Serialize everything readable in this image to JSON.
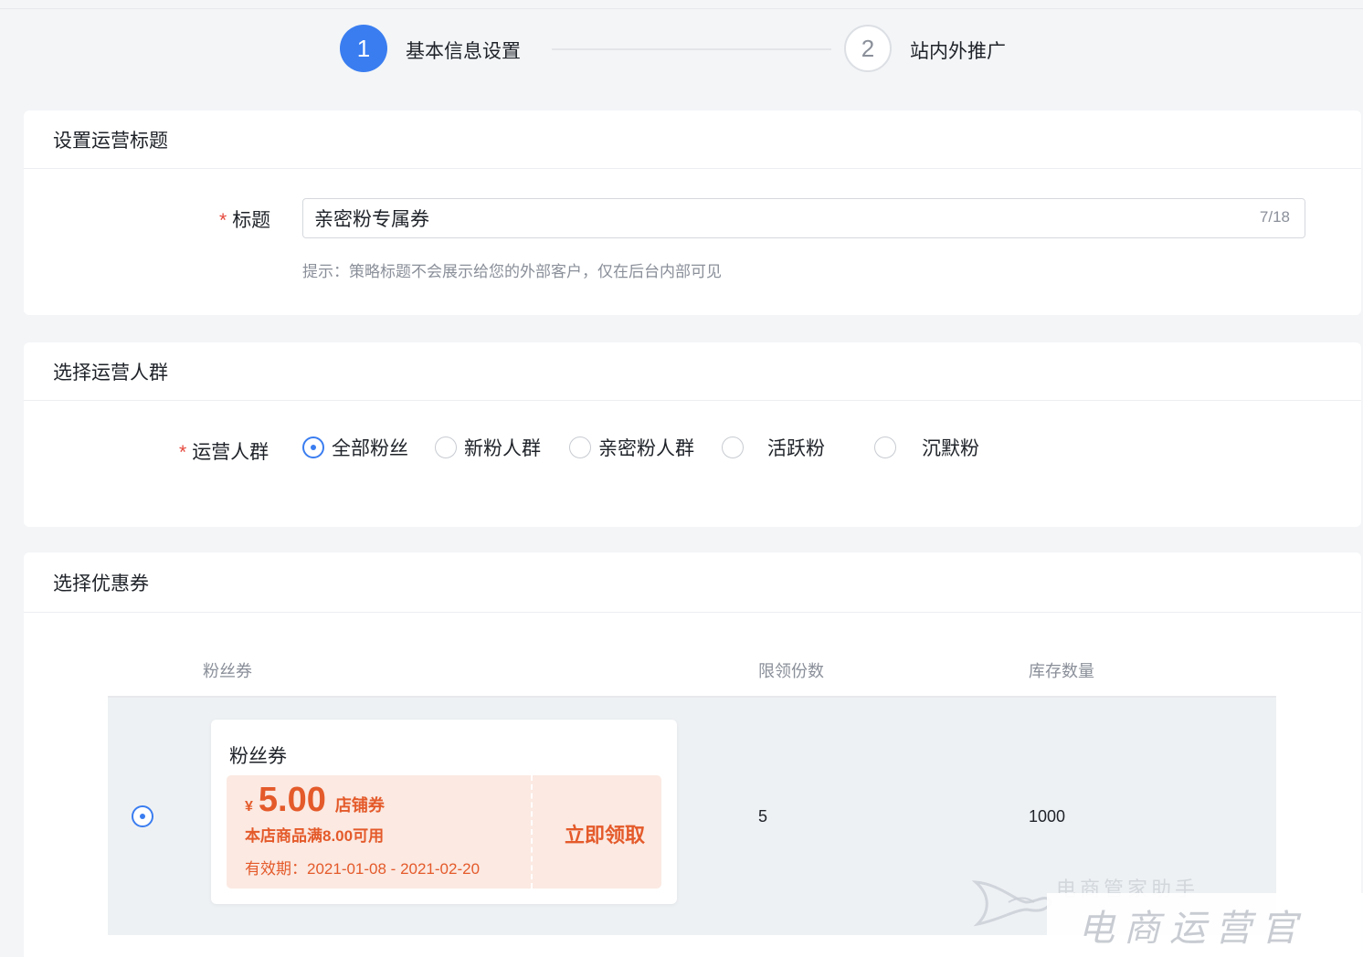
{
  "steps": [
    {
      "number": "1",
      "label": "基本信息设置"
    },
    {
      "number": "2",
      "label": "站内外推广"
    }
  ],
  "section_title": {
    "heading": "设置运营标题",
    "field_label": "标题",
    "value": "亲密粉专属券",
    "counter": "7/18",
    "hint": "提示：策略标题不会展示给您的外部客户，仅在后台内部可见"
  },
  "section_audience": {
    "heading": "选择运营人群",
    "field_label": "运营人群",
    "options": [
      "全部粉丝",
      "新粉人群",
      "亲密粉人群",
      "活跃粉",
      "沉默粉"
    ],
    "selected": "全部粉丝"
  },
  "section_coupon": {
    "heading": "选择优惠券",
    "columns": [
      "粉丝券",
      "限领份数",
      "库存数量"
    ],
    "rows": [
      {
        "name": "粉丝券",
        "currency": "¥",
        "amount": "5.00",
        "type": "店铺券",
        "condition": "本店商品满8.00可用",
        "validity": "有效期：2021-01-08 - 2021-02-20",
        "action": "立即领取",
        "limit": "5",
        "stock": "1000"
      }
    ]
  },
  "watermark": {
    "sub": "电商管家助手",
    "main": "电商运营官"
  },
  "colors": {
    "accent": "#3a7df0",
    "required": "#e5483d",
    "coupon": "#e45a2a",
    "coupon_bg": "#fbe9e2"
  }
}
